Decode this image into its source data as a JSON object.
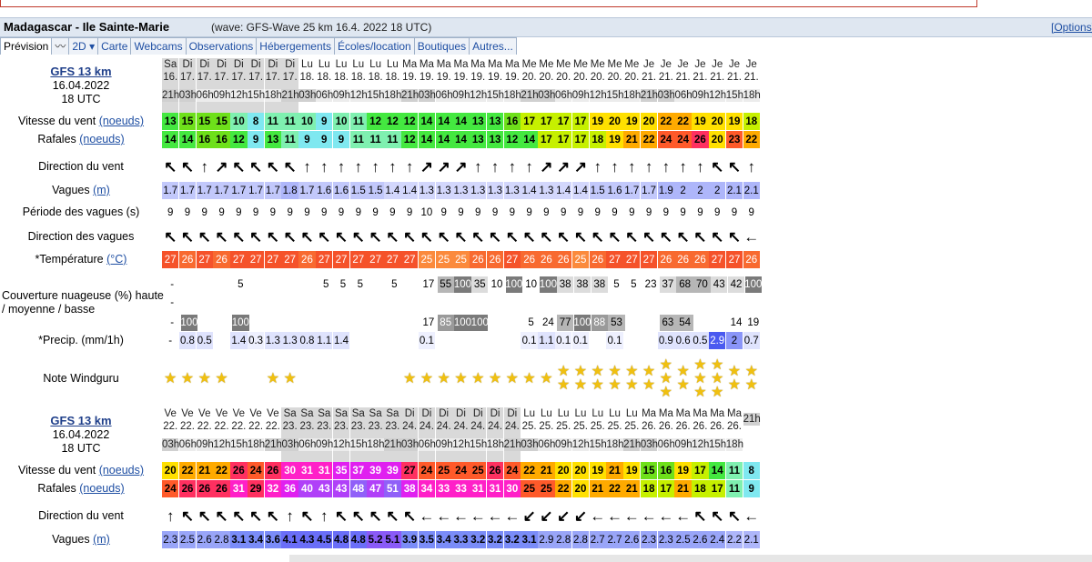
{
  "title": {
    "location": "Madagascar - Ile Sainte-Marie",
    "wave_info": "(wave: GFS-Wave 25 km 16.4. 2022 18 UTC)",
    "options": "[Options]"
  },
  "tabs": [
    "Prévision",
    "2D",
    "Carte",
    "Webcams",
    "Observations",
    "Hébergements",
    "Écoles/location",
    "Boutiques",
    "Autres..."
  ],
  "model": {
    "name": "GFS 13 km",
    "date": "16.04.2022",
    "run": "18 UTC"
  },
  "labels": {
    "wind": "Vitesse du vent",
    "wind_unit": "(noeuds)",
    "gust": "Rafales",
    "gust_unit": "(noeuds)",
    "dir": "Direction du vent",
    "waves": "Vagues",
    "waves_unit": "(m)",
    "period": "Période des vagues (s)",
    "wave_dir": "Direction des vagues",
    "temp": "*Température",
    "temp_unit": "(°C)",
    "cloud": "Couverture nuageuse (%) haute / moyenne / basse",
    "precip": "*Precip. (mm/1h)",
    "rating": "Note Windguru"
  },
  "block1": {
    "days": [
      "Sa",
      "Di",
      "Di",
      "Di",
      "Di",
      "Di",
      "Di",
      "Di",
      "Lu",
      "Lu",
      "Lu",
      "Lu",
      "Lu",
      "Lu",
      "Ma",
      "Ma",
      "Ma",
      "Ma",
      "Ma",
      "Ma",
      "Ma",
      "Me",
      "Me",
      "Me",
      "Me",
      "Me",
      "Me",
      "Me",
      "Je",
      "Je",
      "Je",
      "Je",
      "Je",
      "Je",
      "Je"
    ],
    "dates": [
      "16.",
      "17.",
      "17.",
      "17.",
      "17.",
      "17.",
      "17.",
      "17.",
      "18.",
      "18.",
      "18.",
      "18.",
      "18.",
      "18.",
      "19.",
      "19.",
      "19.",
      "19.",
      "19.",
      "19.",
      "19.",
      "20.",
      "20.",
      "20.",
      "20.",
      "20.",
      "20.",
      "20.",
      "21.",
      "21.",
      "21.",
      "21.",
      "21.",
      "21.",
      "21."
    ],
    "hours": [
      "21h",
      "03h",
      "06h",
      "09h",
      "12h",
      "15h",
      "18h",
      "21h",
      "03h",
      "06h",
      "09h",
      "12h",
      "15h",
      "18h",
      "21h",
      "03h",
      "06h",
      "09h",
      "12h",
      "15h",
      "18h",
      "21h",
      "03h",
      "06h",
      "09h",
      "12h",
      "15h",
      "18h",
      "21h",
      "03h",
      "06h",
      "09h",
      "12h",
      "15h",
      "18h"
    ],
    "wind": [
      13,
      15,
      15,
      15,
      10,
      8,
      11,
      11,
      10,
      9,
      10,
      11,
      12,
      12,
      12,
      14,
      14,
      14,
      13,
      13,
      16,
      17,
      17,
      17,
      17,
      19,
      20,
      19,
      20,
      22,
      22,
      19,
      20,
      19,
      18
    ],
    "gust": [
      14,
      14,
      16,
      16,
      12,
      9,
      13,
      11,
      9,
      9,
      9,
      11,
      11,
      11,
      12,
      14,
      14,
      14,
      13,
      13,
      12,
      14,
      17,
      17,
      17,
      18,
      19,
      21,
      22,
      24,
      24,
      26,
      20,
      23,
      22
    ],
    "dir": [
      "↖",
      "↖",
      "↑",
      "↗",
      "↖",
      "↖",
      "↖",
      "↖",
      "↑",
      "↑",
      "↑",
      "↑",
      "↑",
      "↑",
      "↑",
      "↗",
      "↗",
      "↗",
      "↑",
      "↑",
      "↑",
      "↑",
      "↗",
      "↗",
      "↗",
      "↑",
      "↑",
      "↑",
      "↑",
      "↑",
      "↑",
      "↑",
      "↖",
      "↖",
      "↑"
    ],
    "waves": [
      "1.7",
      "1.7",
      "1.7",
      "1.7",
      "1.7",
      "1.7",
      "1.7",
      "1.8",
      "1.7",
      "1.6",
      "1.6",
      "1.5",
      "1.5",
      "1.4",
      "1.4",
      "1.3",
      "1.3",
      "1.3",
      "1.3",
      "1.3",
      "1.3",
      "1.4",
      "1.3",
      "1.4",
      "1.4",
      "1.5",
      "1.6",
      "1.7",
      "1.7",
      "1.9",
      "2",
      "2",
      "2",
      "2.1",
      "2.1"
    ],
    "period": [
      "9",
      "9",
      "9",
      "9",
      "9",
      "9",
      "9",
      "9",
      "9",
      "9",
      "9",
      "9",
      "9",
      "9",
      "9",
      "10",
      "9",
      "9",
      "9",
      "9",
      "9",
      "9",
      "9",
      "9",
      "9",
      "9",
      "9",
      "9",
      "9",
      "9",
      "9",
      "9",
      "9",
      "9",
      "9"
    ],
    "wave_dir": [
      "↖",
      "↖",
      "↖",
      "↖",
      "↖",
      "↖",
      "↖",
      "↖",
      "↖",
      "↖",
      "↖",
      "↖",
      "↖",
      "↖",
      "↖",
      "↖",
      "↖",
      "↖",
      "↖",
      "↖",
      "↖",
      "↖",
      "↖",
      "↖",
      "↖",
      "↖",
      "↖",
      "↖",
      "↖",
      "↖",
      "↖",
      "↖",
      "↖",
      "↖",
      "←"
    ],
    "temp": [
      27,
      26,
      27,
      26,
      27,
      27,
      27,
      27,
      26,
      27,
      27,
      27,
      27,
      27,
      27,
      25,
      25,
      25,
      26,
      26,
      27,
      26,
      26,
      26,
      25,
      26,
      27,
      27,
      27,
      26,
      26,
      26,
      27,
      27,
      26
    ],
    "cloud_high": [
      "-",
      "",
      "",
      "",
      "5",
      "",
      "",
      "",
      "",
      "5",
      "5",
      "5",
      "",
      "5",
      "",
      "17",
      "55",
      "100",
      "35",
      "10",
      "100",
      "10",
      "100",
      "38",
      "38",
      "38",
      "5",
      "5",
      "23",
      "37",
      "68",
      "70",
      "43",
      "42",
      "100"
    ],
    "cloud_mid": [
      "-",
      "",
      "",
      "",
      "",
      "",
      "",
      "",
      "",
      "",
      "",
      "",
      "",
      "",
      "",
      "",
      "",
      "",
      "",
      "",
      "",
      "",
      "",
      "",
      "",
      "",
      "",
      "",
      "",
      "",
      "",
      "",
      "",
      "",
      ""
    ],
    "cloud_low": [
      "-",
      "100",
      "",
      "",
      "100",
      "",
      "",
      "",
      "",
      "",
      "",
      "",
      "",
      "",
      "",
      "17",
      "85",
      "100",
      "100",
      "",
      "",
      "5",
      "24",
      "77",
      "100",
      "88",
      "53",
      "",
      "",
      "63",
      "54",
      "",
      "",
      "14",
      "19"
    ],
    "precip": [
      "-",
      "0.8",
      "0.5",
      "",
      "1.4",
      "0.3",
      "1.3",
      "1.3",
      "0.8",
      "1.1",
      "1.4",
      "",
      "",
      "",
      "",
      "0.1",
      "",
      "",
      "",
      "",
      "",
      "0.1",
      "1.1",
      "0.1",
      "0.1",
      "",
      "0.1",
      "",
      "",
      "0.9",
      "0.6",
      "0.5",
      "2.9",
      "2",
      "0.7"
    ],
    "stars": [
      1,
      1,
      1,
      1,
      0,
      0,
      1,
      1,
      0,
      0,
      0,
      0,
      0,
      0,
      1,
      1,
      1,
      1,
      1,
      1,
      1,
      1,
      1,
      2,
      2,
      2,
      2,
      2,
      2,
      3,
      2,
      3,
      3,
      2,
      2
    ]
  },
  "block2": {
    "days": [
      "Ve",
      "Ve",
      "Ve",
      "Ve",
      "Ve",
      "Ve",
      "Ve",
      "Sa",
      "Sa",
      "Sa",
      "Sa",
      "Sa",
      "Sa",
      "Sa",
      "Di",
      "Di",
      "Di",
      "Di",
      "Di",
      "Di",
      "Di",
      "Lu",
      "Lu",
      "Lu",
      "Lu",
      "Lu",
      "Lu",
      "Lu",
      "Ma",
      "Ma",
      "Ma",
      "Ma",
      "Ma",
      "Ma"
    ],
    "dates": [
      "22.",
      "22.",
      "22.",
      "22.",
      "22.",
      "22.",
      "22.",
      "23.",
      "23.",
      "23.",
      "23.",
      "23.",
      "23.",
      "23.",
      "24.",
      "24.",
      "24.",
      "24.",
      "24.",
      "24.",
      "24.",
      "25.",
      "25.",
      "25.",
      "25.",
      "25.",
      "25.",
      "25.",
      "26.",
      "26.",
      "26.",
      "26.",
      "26.",
      "26."
    ],
    "hours": [
      "03h",
      "06h",
      "09h",
      "12h",
      "15h",
      "18h",
      "21h",
      "03h",
      "06h",
      "09h",
      "12h",
      "15h",
      "18h",
      "21h",
      "03h",
      "06h",
      "09h",
      "12h",
      "15h",
      "18h",
      "21h",
      "03h",
      "06h",
      "09h",
      "12h",
      "15h",
      "18h",
      "21h",
      "03h",
      "06h",
      "09h",
      "12h",
      "15h",
      "18h",
      "21h"
    ],
    "wind": [
      20,
      22,
      21,
      22,
      26,
      24,
      26,
      30,
      31,
      31,
      35,
      37,
      39,
      39,
      27,
      24,
      25,
      24,
      25,
      26,
      24,
      22,
      21,
      20,
      20,
      19,
      21,
      19,
      15,
      16,
      19,
      17,
      14,
      11,
      8
    ],
    "gust": [
      24,
      26,
      26,
      26,
      31,
      29,
      32,
      36,
      40,
      43,
      43,
      48,
      47,
      51,
      38,
      34,
      33,
      33,
      31,
      31,
      30,
      25,
      25,
      22,
      20,
      21,
      22,
      21,
      18,
      17,
      21,
      18,
      17,
      11,
      9
    ],
    "dir": [
      "↑",
      "↖",
      "↖",
      "↖",
      "↖",
      "↖",
      "↖",
      "↑",
      "↖",
      "↑",
      "↖",
      "↖",
      "↖",
      "↖",
      "↖",
      "←",
      "←",
      "←",
      "←",
      "←",
      "←",
      "↙",
      "↙",
      "↙",
      "↙",
      "←",
      "←",
      "←",
      "←",
      "←",
      "←",
      "↖",
      "↖",
      "↖",
      "←"
    ],
    "waves": [
      "2.3",
      "2.5",
      "2.6",
      "2.8",
      "3.1",
      "3.4",
      "3.6",
      "4.1",
      "4.3",
      "4.5",
      "4.8",
      "4.8",
      "5.2",
      "5.1",
      "3.9",
      "3.5",
      "3.4",
      "3.3",
      "3.2",
      "3.2",
      "3.2",
      "3.1",
      "2.9",
      "2.8",
      "2.8",
      "2.7",
      "2.7",
      "2.6",
      "2.3",
      "2.3",
      "2.5",
      "2.6",
      "2.4",
      "2.2",
      "2.1"
    ]
  },
  "colors": {
    "title_bg": "#dfe7f1",
    "link": "#1f4fa3",
    "accent": "#c0392b"
  }
}
